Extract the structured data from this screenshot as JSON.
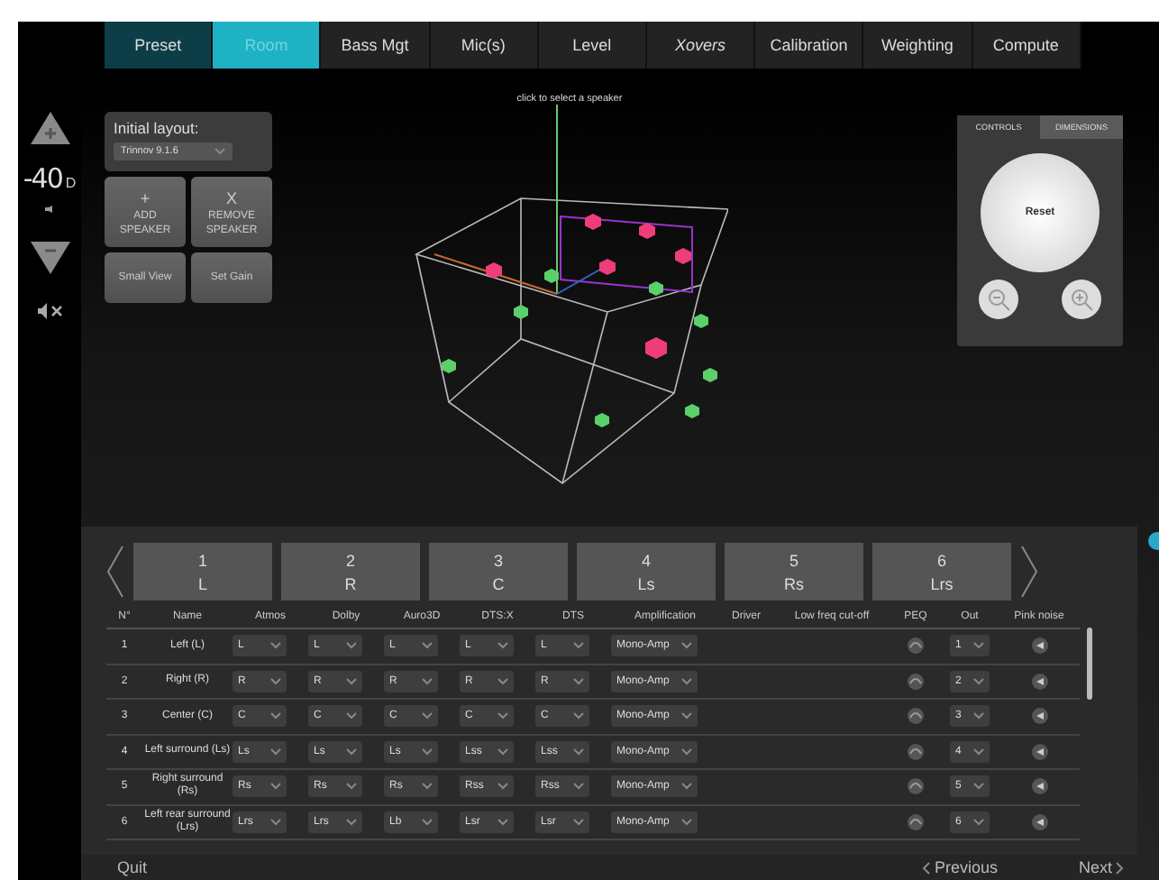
{
  "tabs": [
    {
      "label": "Preset",
      "selected": false,
      "completed": true,
      "disabled": false
    },
    {
      "label": "Room",
      "selected": true,
      "completed": false,
      "disabled": false
    },
    {
      "label": "Bass Mgt",
      "selected": false,
      "completed": false,
      "disabled": false
    },
    {
      "label": "Mic(s)",
      "selected": false,
      "completed": false,
      "disabled": false
    },
    {
      "label": "Level",
      "selected": false,
      "completed": false,
      "disabled": false
    },
    {
      "label": "Xovers",
      "selected": false,
      "completed": false,
      "disabled": true
    },
    {
      "label": "Calibration",
      "selected": false,
      "completed": false,
      "disabled": false
    },
    {
      "label": "Weighting",
      "selected": false,
      "completed": false,
      "disabled": false
    },
    {
      "label": "Compute",
      "selected": false,
      "completed": false,
      "disabled": false
    }
  ],
  "volume": {
    "reading": "-40",
    "unit": "D"
  },
  "layout_panel": {
    "label": "Initial layout:",
    "value": "Trinnov 9.1.6",
    "actions": [
      {
        "symbol": "+",
        "line1": "ADD",
        "line2": "SPEAKER"
      },
      {
        "symbol": "X",
        "line1": "REMOVE",
        "line2": "SPEAKER"
      }
    ],
    "buttons": [
      "Small View",
      "Set Gain"
    ]
  },
  "room_view": {
    "hint": "click to select a speaker"
  },
  "nav_pad": {
    "tabs": [
      {
        "label": "CONTROLS",
        "selected": true
      },
      {
        "label": "DIMENSIONS",
        "selected": false
      }
    ],
    "reset": "Reset"
  },
  "speakers": [
    {
      "number": "1",
      "name": "L"
    },
    {
      "number": "2",
      "name": "R"
    },
    {
      "number": "3",
      "name": "C"
    },
    {
      "number": "4",
      "name": "Ls"
    },
    {
      "number": "5",
      "name": "Rs"
    },
    {
      "number": "6",
      "name": "Lrs"
    }
  ],
  "table": {
    "columns": [
      "N°",
      "Name",
      "Atmos",
      "Dolby",
      "Auro3D",
      "DTS:X",
      "DTS",
      "Amplification",
      "Driver",
      "Low freq cut-off",
      "PEQ",
      "Out",
      "Pink noise"
    ],
    "rows": [
      {
        "number": "1",
        "name": "Left (L)",
        "atmos": "L",
        "dolby": "L",
        "auro3d": "L",
        "dtsx": "L",
        "dts": "L",
        "amplification": "Mono-Amp",
        "out": "1"
      },
      {
        "number": "2",
        "name": "Right (R)",
        "atmos": "R",
        "dolby": "R",
        "auro3d": "R",
        "dtsx": "R",
        "dts": "R",
        "amplification": "Mono-Amp",
        "out": "2"
      },
      {
        "number": "3",
        "name": "Center (C)",
        "atmos": "C",
        "dolby": "C",
        "auro3d": "C",
        "dtsx": "C",
        "dts": "C",
        "amplification": "Mono-Amp",
        "out": "3"
      },
      {
        "number": "4",
        "name": "Left surround (Ls)",
        "atmos": "Ls",
        "dolby": "Ls",
        "auro3d": "Ls",
        "dtsx": "Lss",
        "dts": "Lss",
        "amplification": "Mono-Amp",
        "out": "4"
      },
      {
        "number": "5",
        "name": "Right surround (Rs)",
        "atmos": "Rs",
        "dolby": "Rs",
        "auro3d": "Rs",
        "dtsx": "Rss",
        "dts": "Rss",
        "amplification": "Mono-Amp",
        "out": "5"
      },
      {
        "number": "6",
        "name": "Left rear surround (Lrs)",
        "atmos": "Lrs",
        "dolby": "Lrs",
        "auro3d": "Lb",
        "dtsx": "Lsr",
        "dts": "Lsr",
        "amplification": "Mono-Amp",
        "out": "6"
      }
    ]
  },
  "footer": {
    "quit": "Quit",
    "previous": "Previous",
    "next": "Next"
  }
}
